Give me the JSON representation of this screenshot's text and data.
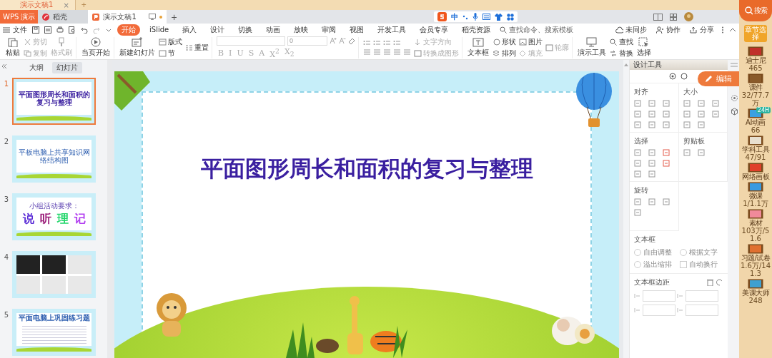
{
  "browser_tab": {
    "title": "演示文稿1",
    "close": "×",
    "new_tab": "+"
  },
  "title_bar": {
    "tabs": [
      {
        "label": "WPS 演示",
        "kind": "app",
        "selected": false,
        "modified": false
      },
      {
        "label": "稻壳",
        "kind": "store",
        "selected": false,
        "modified": false
      },
      {
        "label": "演示文稿1",
        "kind": "doc",
        "selected": true,
        "modified": true
      }
    ],
    "new_tab": "+",
    "ime": "中"
  },
  "menu": {
    "file": "文件",
    "tabs": [
      {
        "label": "开始",
        "selected": true
      },
      {
        "label": "iSlide",
        "selected": false
      },
      {
        "label": "插入",
        "selected": false
      },
      {
        "label": "设计",
        "selected": false
      },
      {
        "label": "切换",
        "selected": false
      },
      {
        "label": "动画",
        "selected": false
      },
      {
        "label": "放映",
        "selected": false
      },
      {
        "label": "审阅",
        "selected": false
      },
      {
        "label": "视图",
        "selected": false
      },
      {
        "label": "开发工具",
        "selected": false
      },
      {
        "label": "会员专享",
        "selected": false
      },
      {
        "label": "稻壳资源",
        "selected": false
      }
    ],
    "search": {
      "placeholder": "查找命令、搜索模板"
    },
    "actions": [
      {
        "label": "未同步",
        "kind": "cloud"
      },
      {
        "label": "协作",
        "kind": "person"
      },
      {
        "label": "分享",
        "kind": "share"
      }
    ]
  },
  "ribbon": {
    "clipboard": {
      "paste": "粘贴",
      "cut": "剪切",
      "copy": "复制",
      "painter": "格式刷"
    },
    "play": "当页开始",
    "slides": {
      "new": "新建幻灯片",
      "layout": "版式",
      "reset": "重置",
      "section": "节"
    },
    "font": {
      "size": "0",
      "format": [
        "B",
        "I",
        "U",
        "S",
        "A",
        "X$^{2}$",
        "X$_{2}$"
      ]
    },
    "paragraph": {
      "direction": "文字方向",
      "convert": "转换成图形"
    },
    "insert": {
      "textbox": "文本框",
      "shape": "形状",
      "arrange": "排列",
      "picture": "图片",
      "fill": "填充",
      "outline": "轮廓"
    },
    "tools": {
      "present": "演示工具",
      "find": "查找",
      "replace": "替换",
      "select": "选择"
    }
  },
  "outline_tabs": [
    {
      "label": "大纲",
      "selected": false
    },
    {
      "label": "幻灯片",
      "selected": true
    }
  ],
  "slides": [
    {
      "number": "1",
      "kind": "title",
      "selected": true,
      "title": "平面图形周长和面积的复习与整理"
    },
    {
      "number": "2",
      "kind": "heading",
      "selected": false,
      "title": "平板电脑上共享知识网络结构图"
    },
    {
      "number": "3",
      "kind": "words",
      "selected": false,
      "title": "小组活动要求：",
      "words": [
        {
          "text": "说",
          "color": "#5a2bd6"
        },
        {
          "text": "听",
          "color": "#9b1f7a"
        },
        {
          "text": "理",
          "color": "#22d66a"
        },
        {
          "text": "记",
          "color": "#b13cf0"
        }
      ]
    },
    {
      "number": "4",
      "kind": "pictures",
      "selected": false
    },
    {
      "number": "5",
      "kind": "exercise",
      "selected": false,
      "title": "平面电脑上巩固练习题"
    }
  ],
  "slide": {
    "title": "平面图形周长和面积的复习与整理"
  },
  "design_panel": {
    "title": "设计工具",
    "edit_button": "编辑",
    "sections": [
      {
        "title": "对齐",
        "kind": "align"
      },
      {
        "title": "大小",
        "kind": "size"
      },
      {
        "title": "选择",
        "kind": "select"
      },
      {
        "title": "剪贴板",
        "kind": "clipboard"
      },
      {
        "title": "旋转",
        "kind": "rotate"
      }
    ],
    "text_box": {
      "title": "文本框",
      "options": [
        {
          "label": "自由调整",
          "kind": "radio",
          "checked": false
        },
        {
          "label": "根据文字",
          "kind": "radio",
          "checked": false
        },
        {
          "label": "溢出缩排",
          "kind": "radio",
          "checked": false
        },
        {
          "label": "自动换行",
          "kind": "checkbox",
          "checked": false
        }
      ]
    },
    "margins": {
      "title": "文本框边距"
    }
  },
  "sidebar": {
    "search": "搜索",
    "chapter": "章节选择",
    "items": [
      {
        "label": "迪士尼",
        "count": "465"
      },
      {
        "label": "课件",
        "count": "32/77.7万"
      },
      {
        "label": "AI动画",
        "count": "66",
        "badge": "24H"
      },
      {
        "label": "学科工具",
        "count": "47/91"
      },
      {
        "label": "网络画板"
      },
      {
        "label": "微课",
        "count": "1/1.1万"
      },
      {
        "label": "素材",
        "count": "103万/51.6"
      },
      {
        "label": "习题/试卷",
        "count": "1.6万/141.3"
      },
      {
        "label": "美课大师",
        "count": "248"
      }
    ]
  }
}
